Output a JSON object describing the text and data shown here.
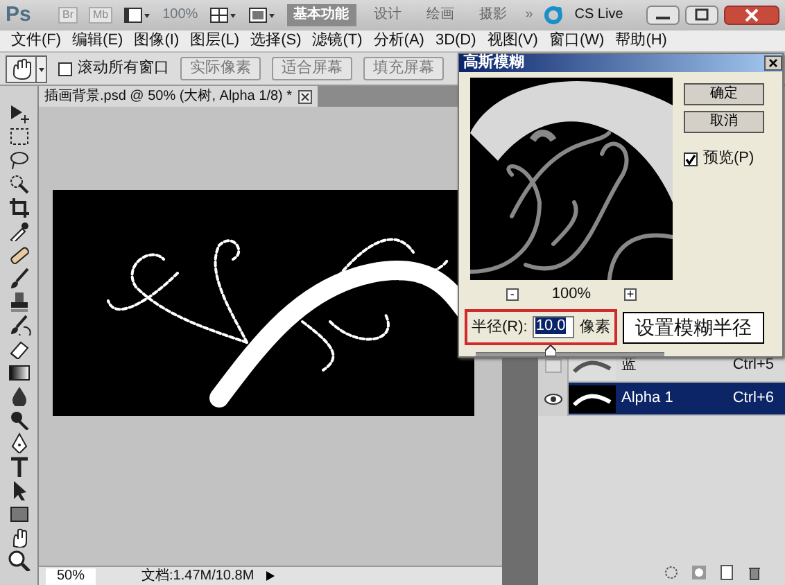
{
  "app_bar": {
    "logo": "Ps",
    "apps": [
      "Br",
      "Mb"
    ],
    "zoom": "100%",
    "workspaces": [
      {
        "label": "基本功能",
        "selected": true
      },
      {
        "label": "设计",
        "selected": false
      },
      {
        "label": "绘画",
        "selected": false
      },
      {
        "label": "摄影",
        "selected": false
      }
    ],
    "more": "»",
    "cs_live": "CS Live"
  },
  "menu": [
    "文件(F)",
    "编辑(E)",
    "图像(I)",
    "图层(L)",
    "选择(S)",
    "滤镜(T)",
    "分析(A)",
    "3D(D)",
    "视图(V)",
    "窗口(W)",
    "帮助(H)"
  ],
  "options_bar": {
    "scroll_all": {
      "label": "滚动所有窗口",
      "checked": false
    },
    "buttons": [
      {
        "label": "实际像素"
      },
      {
        "label": "适合屏幕"
      },
      {
        "label": "填充屏幕"
      }
    ]
  },
  "document": {
    "tab": "插画背景.psd @ 50% (大树, Alpha 1/8) *",
    "zoom": "50%",
    "doc_size": "文档:1.47M/10.8M"
  },
  "channels": [
    {
      "name": "蓝",
      "shortcut": "Ctrl+5",
      "visible": false,
      "selected": false
    },
    {
      "name": "Alpha 1",
      "shortcut": "Ctrl+6",
      "visible": true,
      "selected": true
    }
  ],
  "dialog": {
    "title": "高斯模糊",
    "buttons": [
      "确定",
      "取消"
    ],
    "preview": {
      "label": "预览(P)",
      "checked": true
    },
    "zoom_out": "-",
    "zoom": "100%",
    "zoom_in": "+",
    "radius_label": "半径(R):",
    "radius": "10.0",
    "unit": "像素",
    "level": 0.4,
    "callout": "设置模糊半径"
  }
}
